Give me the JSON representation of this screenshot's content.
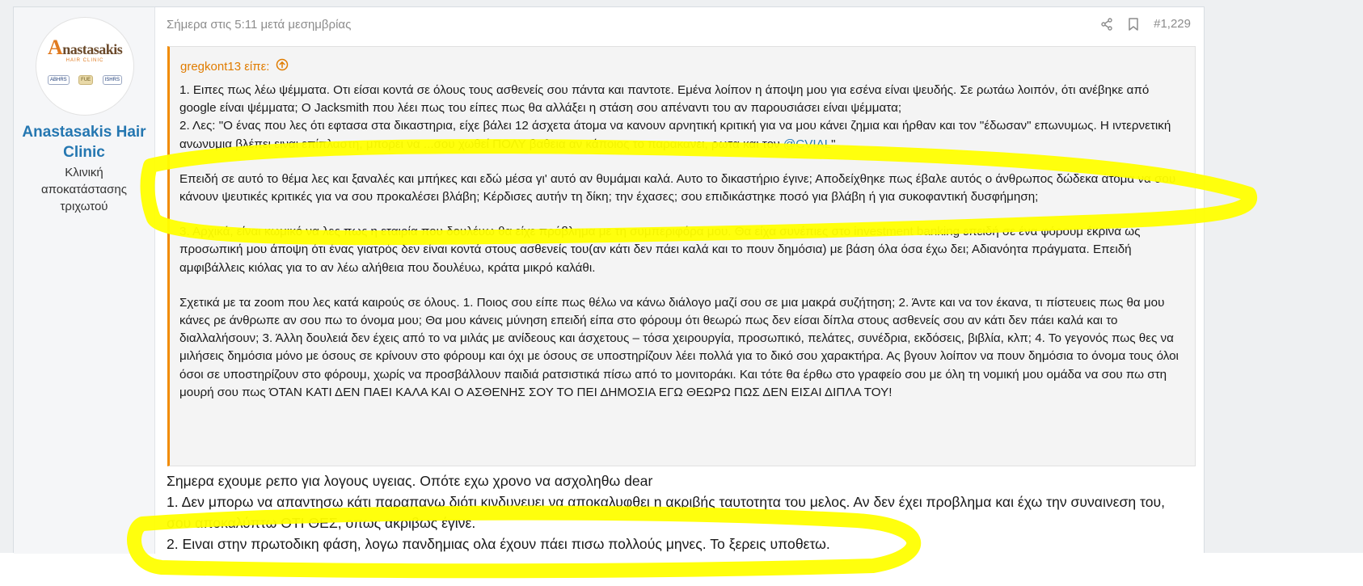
{
  "post": {
    "date": "Σήμερα στις 5:11 μετά μεσημβρίας",
    "number": "#1,229",
    "author": {
      "name": "Anastasakis Hair Clinic",
      "title": "Κλινική αποκατάστασης τριχωτού",
      "logo_text": "Anastasakis",
      "logo_sub": "HAIR CLINIC",
      "badges": [
        "ABHRS",
        "FUE",
        "ISHRS"
      ]
    },
    "quote": {
      "author": "gregkont13 είπε:",
      "p1": "1. Ειπες πως λέω ψέμματα. Οτι είσαι κοντά σε όλους τους ασθενείς σου πάντα και παντοτε. Εμένα λοίπον η άποψη μου για εσένα είναι ψευδής. Σε ρωτάω λοιπόν, ότι ανέβηκε από google είναι ψέμματα; Ο Jacksmith που λέει πως του είπες πως θα αλλάξει η στάση σου απέναντι του αν παρουσιάσει είναι ψέμματα;",
      "p1b": "2. Λες: \"Ο ένας που λες ότι εφτασα στα δικαστηρια, είχε βάλει 12 άσχετα άτομα να κανουν αρνητική κριτική για να μου κάνει ζημια και ήρθαν και τον \"έδωσαν\" επωνυμως. Η ιντερνετική ανωνυμια βλέπει ειναι επίπλαστη, μπορει να ...σου χωθεί ΠΟΛΥ βαθεια αν κάποιος το παρακανει, ρωτα και τον ",
      "mention": "@CVIAL",
      "p1b_end": "\"",
      "p2": "Επειδή σε αυτό το θέμα λες και ξαναλές και μπήκες και εδώ μέσα γι' αυτό αν θυμάμαι καλά. Αυτο το δικαστήριο έγινε; Αποδείχθηκε πως έβαλε αυτός ο άνθρωπος δώδεκα άτομα να σου κάνουν ψευτικές κριτικές για να σου προκαλέσει βλάβη; Κέρδισες αυτήν τη δίκη; την έχασες; σου επιδικάστηκε ποσό για βλάβη ή για συκοφαντική δυσφήμηση;",
      "p3": "3. Αρχικά, είναι κωμικό να λες πως η εταιρία που δουλέυω θα είχε πρόβλημα με τη συμπεριφόρα μου. Θα είχα συνέπιες στο investment banking επειδή σε ένα φόρουμ έκρινα ως προσωπική μου άποψη ότι ένας γιατρός δεν είναι κοντά στους ασθενείς του(αν κάτι δεν πάει καλά και το πουν δημόσια) με βάση όλα όσα έχω δει; Αδιανόητα πράγματα. Επειδή αμφιβάλλεις κιόλας για το αν λέω αλήθεια που δουλέυω, κράτα μικρό καλάθι.",
      "p4": "Σχετικά με τα zoom που λες κατά καιρούς σε όλους. 1. Ποιος σου είπε πως θέλω να κάνω διάλογο μαζί σου σε μια μακρά συζήτηση; 2. Άντε και να τον έκανα, τι πίστευεις πως θα μου κάνες ρε άνθρωπε αν σου πω το όνομα μου; Θα μου κάνεις μύνηση επειδή είπα στο φόρουμ ότι θεωρώ πως δεν είσαι δίπλα στους ασθενείς σου αν κάτι δεν πάει καλά και το διαλλαλήσουν; 3. Άλλη δουλειά δεν έχεις από το να μιλάς με ανίδεους και άσχετους – τόσα χειρουργία, προσωπικό, πελάτες, συνέδρια, εκδόσεις, βιβλία, κλπ; 4. Το γεγονός πως θες να μιλήσεις δημόσια μόνο με όσους σε κρίνουν στο φόρουμ και όχι με όσους σε υποστηρίζουν λέει πολλά για το δικό σου χαρακτήρα. Ας βγουν λοίπον να πουν δημόσια το όνομα τους όλοι όσοι σε υποστηρίζουν στο φόρουμ, χωρίς να προσβάλλουν παιδιά ρατσιστικά πίσω από το μονιτοράκι. Και τότε θα έρθω στο γραφείο σου με όλη τη νομική μου ομάδα να σου πω στη μουρή σου πως ΌΤΑΝ ΚΑΤΙ ΔΕΝ ΠΑΕΙ ΚΑΛΑ ΚΑΙ Ο ΑΣΘΕΝΗΣ ΣΟΥ ΤΟ ΠΕΙ ΔΗΜΟΣΙΑ ΕΓΩ ΘΕΩΡΩ ΠΩΣ ΔΕΝ ΕΙΣΑΙ ΔΙΠΛΑ ΤΟΥ!"
    },
    "reply": {
      "line1": "Σημερα εχουμε ρεπο για λογους υγειας. Οπότε εχω χρονο να ασχοληθω dear",
      "line2": "1. Δεν μπορω να απαντησω κάτι παραπανω διότι κινδυνευει να αποκαλυφθει η ακριβής ταυτοτητα του μελος. Αν δεν έχει προβλημα και έχω την συναινεση του, σου αποκαλύπτω ΟΤΙ ΘΕΣ, οπως ακριβως έγινε.",
      "line3": "2. Ειναι στην πρωτοδικη φάση, λογω πανδημιας ολα έχουν πάει πισω πολλούς μηνες. Το ξερεις υποθετω."
    }
  },
  "colors": {
    "highlight": "#ffff00",
    "quote_accent": "#f28b00",
    "link": "#2577b1"
  }
}
